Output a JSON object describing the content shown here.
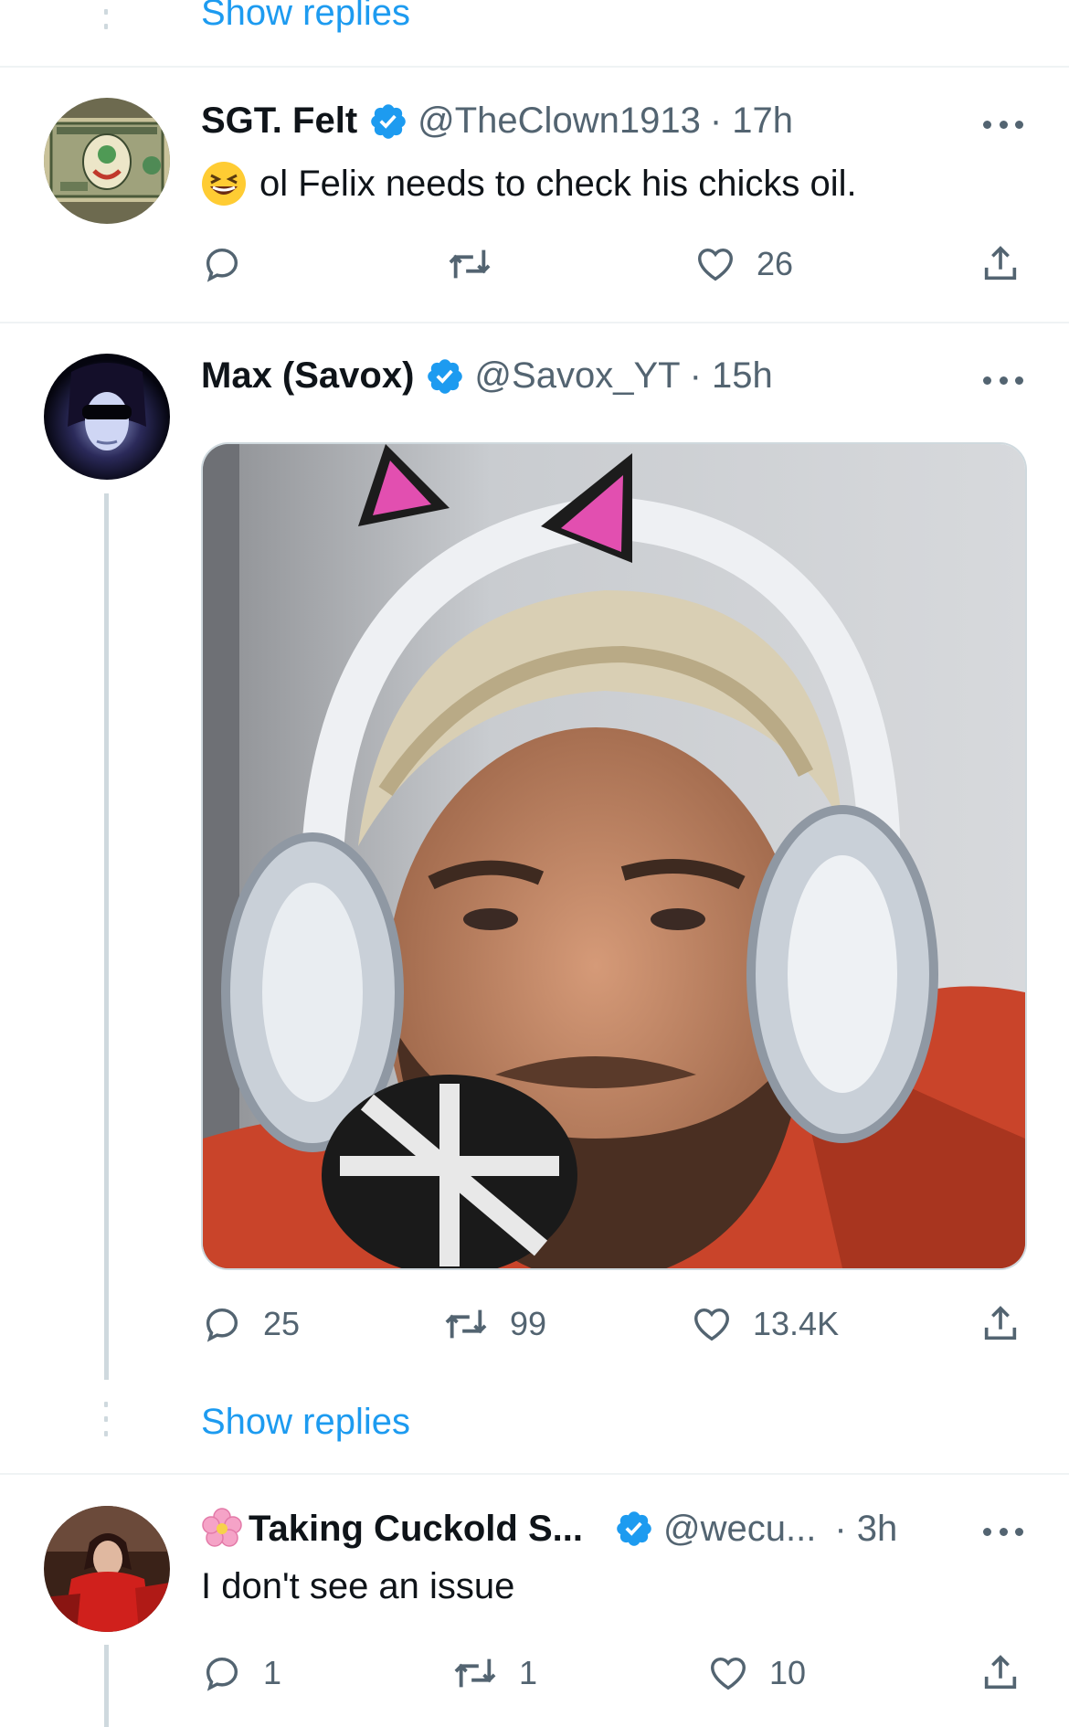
{
  "top": {
    "show_replies": "Show replies"
  },
  "tweets": [
    {
      "name": "SGT. Felt",
      "handle": "@TheClown1913",
      "time": "· 17h",
      "text": "ol Felix needs to check his chicks oil.",
      "emoji": "laughing-face-emoji",
      "actions": {
        "replies": "",
        "retweets": "",
        "likes": "26"
      }
    },
    {
      "name": "Max (Savox)",
      "handle": "@Savox_YT",
      "time": "· 15h",
      "media": "photo-man-wearing-cat-ear-headphones",
      "actions": {
        "replies": "25",
        "retweets": "99",
        "likes": "13.4K"
      },
      "show_replies": "Show replies"
    },
    {
      "name": "Taking Cuckold S...",
      "name_prefix_icon": "cherry-blossom-emoji",
      "handle": "@wecu...",
      "time": "· 3h",
      "text": "I don't see an issue",
      "actions": {
        "replies": "1",
        "retweets": "1",
        "likes": "10"
      }
    }
  ],
  "colors": {
    "accent": "#1d9bf0",
    "secondary_text": "#536471",
    "divider": "#eff3f4"
  }
}
